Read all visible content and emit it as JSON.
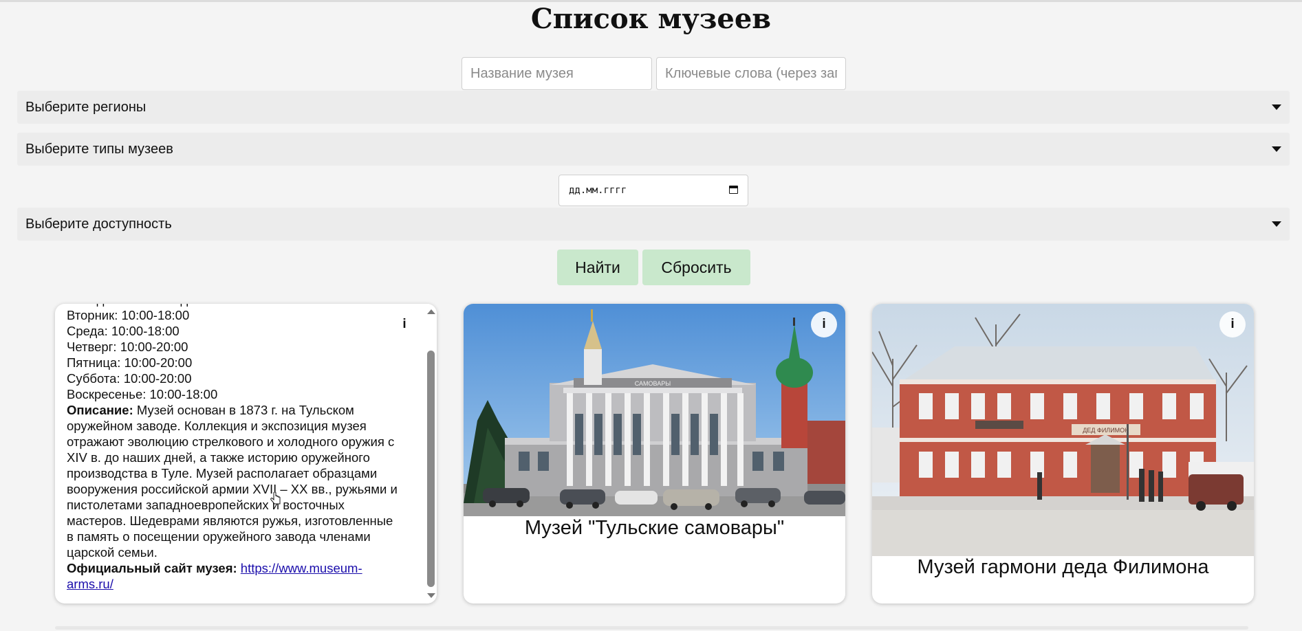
{
  "page": {
    "title": "Список музеев"
  },
  "search": {
    "name_placeholder": "Название музея",
    "keywords_placeholder": "Ключевые слова (через запятую)"
  },
  "filters": {
    "regions": "Выберите регионы",
    "types": "Выберите типы музеев",
    "date_placeholder": "дд.мм.гггг",
    "accessibility": "Выберите доступность"
  },
  "buttons": {
    "find": "Найти",
    "reset": "Сбросить"
  },
  "cards": [
    {
      "info": "i",
      "hours": [
        "Вторник: 10:00-18:00",
        "Среда: 10:00-18:00",
        "Четверг: 10:00-20:00",
        "Пятница: 10:00-20:00",
        "Суббота: 10:00-20:00",
        "Воскресенье: 10:00-18:00"
      ],
      "description_label": "Описание:",
      "description": "Музей основан в 1873 г. на Тульском оружейном заводе. Коллекция и экспозиция музея отражают эволюцию стрелкового и холодного оружия с XIV в. до наших дней, а также историю оружейного производства в Туле. Музей располагает образцами вооружения российской армии XVII – XX вв., ружьями и пистолетами западноевропейских и восточных мастеров. Шедеврами являются ружья, изготовленные в память о посещении оружейного завода членами царской семьи.",
      "site_label": "Официальный сайт музея:",
      "site_url": "https://www.museum-arms.ru/"
    },
    {
      "info": "i",
      "name": "Музей \"Тульские самовары\"",
      "building_sign": "САМОВАРЫ"
    },
    {
      "info": "i",
      "name": "Музей гармони деда Филимона",
      "building_sign": "ДЕД ФИЛИМОН"
    }
  ],
  "colors": {
    "background": "#f4f4f4",
    "filter_bar": "#ececec",
    "button": "#c9e8cc",
    "link": "#1a0dab"
  }
}
